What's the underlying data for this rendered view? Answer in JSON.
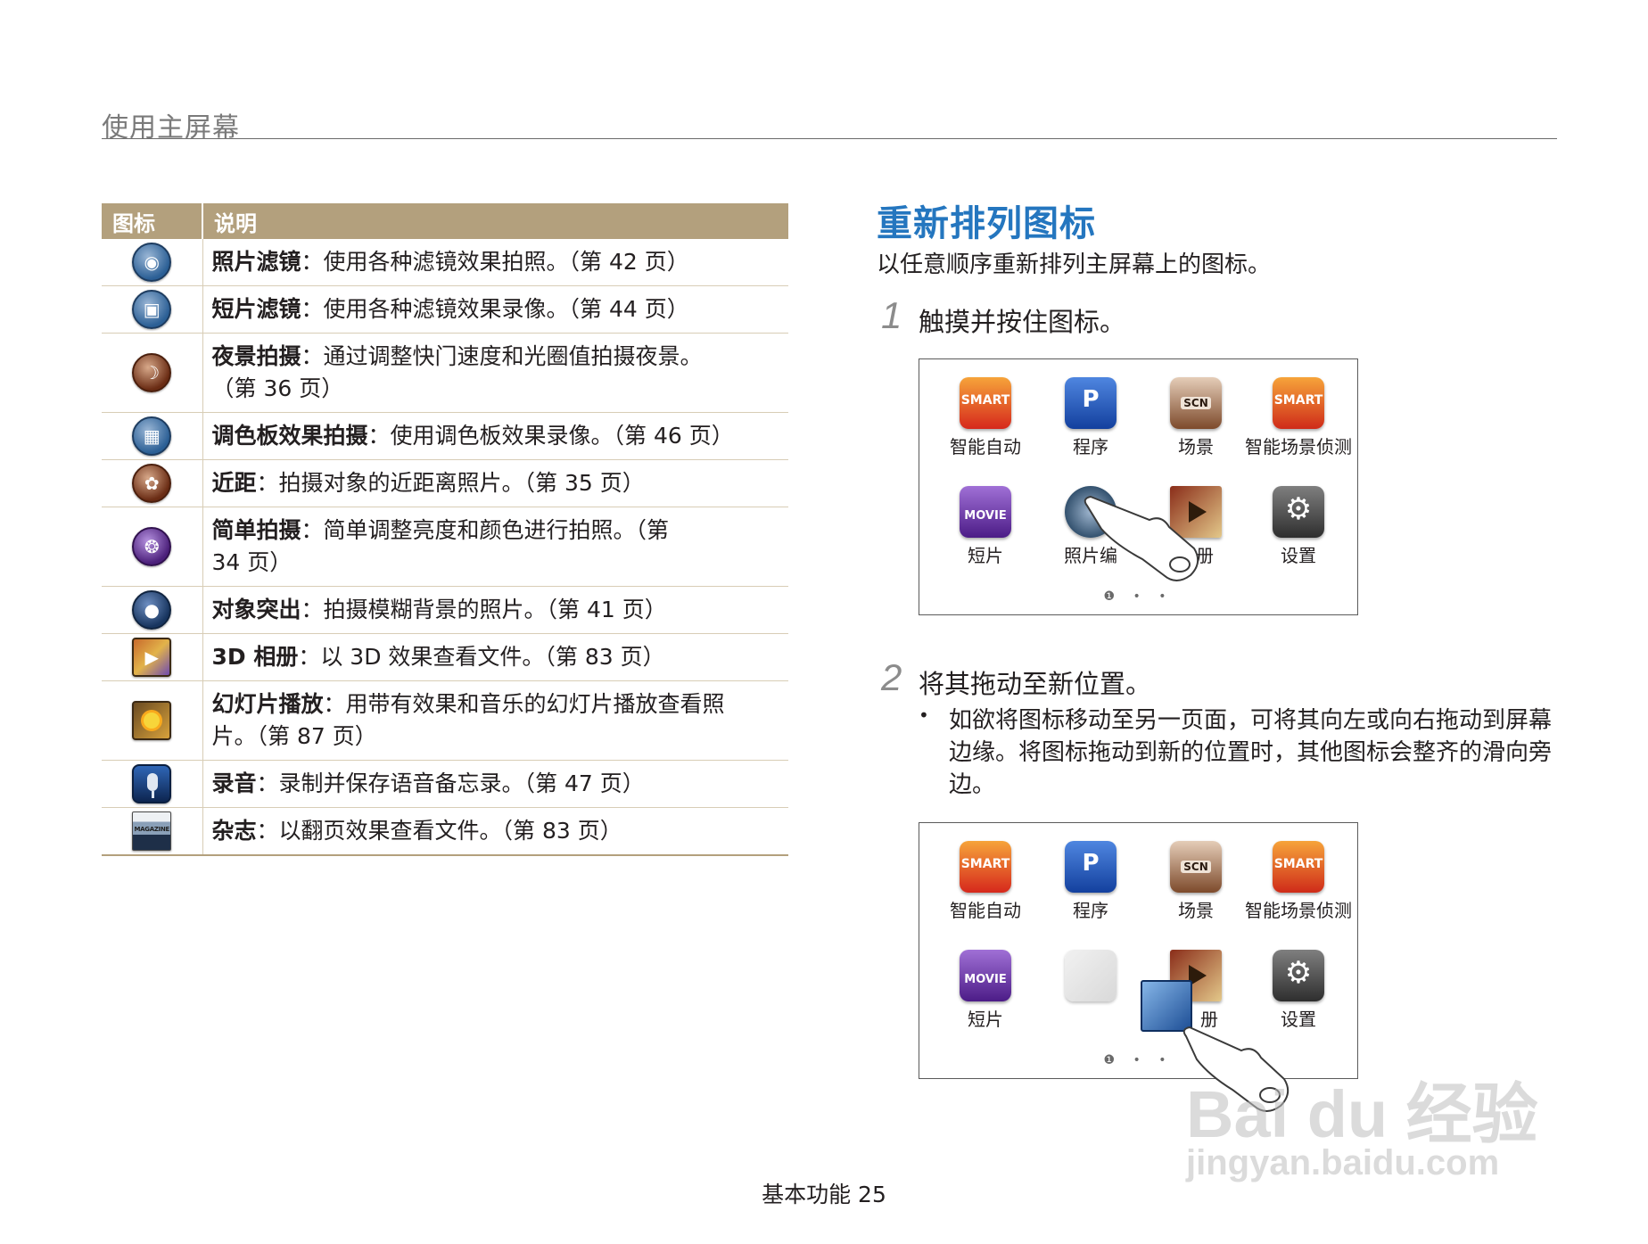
{
  "header": {
    "title": "使用主屏幕"
  },
  "table": {
    "col_icon": "图标",
    "col_desc": "说明",
    "rows": [
      {
        "icon": "photo-filter-icon",
        "name": "照片滤镜",
        "desc": "：使用各种滤镜效果拍照。（第 42 页）"
      },
      {
        "icon": "movie-filter-icon",
        "name": "短片滤镜",
        "desc": "：使用各种滤镜效果录像。（第 44 页）"
      },
      {
        "icon": "night-shot-icon",
        "name": "夜景拍摄",
        "desc": "：通过调整快门速度和光圈值拍摄夜景。（第 36 页）"
      },
      {
        "icon": "palette-effect-icon",
        "name": "调色板效果拍摄",
        "desc": "：使用调色板效果录像。（第 46 页）"
      },
      {
        "icon": "close-up-icon",
        "name": "近距",
        "desc": "：拍摄对象的近距离照片。（第 35 页）"
      },
      {
        "icon": "easy-shot-icon",
        "name": "简单拍摄",
        "desc": "：简单调整亮度和颜色进行拍照。（第 34 页）"
      },
      {
        "icon": "object-highlight-icon",
        "name": "对象突出",
        "desc": "：拍摄模糊背景的照片。（第 41 页）"
      },
      {
        "icon": "3d-album-icon",
        "name": "3D 相册",
        "desc": "：以 3D 效果查看文件。（第 83 页）"
      },
      {
        "icon": "slideshow-icon",
        "name": "幻灯片播放",
        "desc": "：用带有效果和音乐的幻灯片播放查看照片。（第 87 页）"
      },
      {
        "icon": "voice-record-icon",
        "name": "录音",
        "desc": "：录制并保存语音备忘录。（第 47 页）"
      },
      {
        "icon": "magazine-icon",
        "name": "杂志",
        "desc": "：以翻页效果查看文件。（第 83 页）"
      }
    ],
    "magazine_text": "MAGAZINE"
  },
  "section": {
    "title": "重新排列图标",
    "intro": "以任意顺序重新排列主屏幕上的图标。",
    "step1_num": "1",
    "step1_text": "触摸并按住图标。",
    "step2_num": "2",
    "step2_text": "将其拖动至新位置。",
    "bullet_mark": "•",
    "bullet_text": "如欲将图标移动至另一页面，可将其向左或向右拖动到屏幕边缘。将图标拖动到新的位置时，其他图标会整齐的滑向旁边。"
  },
  "screen1": {
    "apps": [
      {
        "icon": "smart-auto-icon",
        "badge": "SMART",
        "label": "智能自动"
      },
      {
        "icon": "program-icon",
        "badge": "P",
        "label": "程序"
      },
      {
        "icon": "scene-icon",
        "badge": "SCN",
        "label": "场景"
      },
      {
        "icon": "smart-scene-icon",
        "badge": "SMART",
        "label": "智能场景侦测"
      },
      {
        "icon": "movie-icon",
        "badge": "MOVIE",
        "label": "短片"
      },
      {
        "icon": "photo-edit-icon",
        "badge": "",
        "label": "照片编"
      },
      {
        "icon": "album-icon",
        "badge": "",
        "label": "相册"
      },
      {
        "icon": "settings-icon",
        "badge": "⚙",
        "label": "设置"
      }
    ],
    "dots": "❶ • •"
  },
  "screen2": {
    "apps": [
      {
        "icon": "smart-auto-icon",
        "badge": "SMART",
        "label": "智能自动"
      },
      {
        "icon": "program-icon",
        "badge": "P",
        "label": "程序"
      },
      {
        "icon": "scene-icon",
        "badge": "SCN",
        "label": "场景"
      },
      {
        "icon": "smart-scene-icon",
        "badge": "SMART",
        "label": "智能场景侦测"
      },
      {
        "icon": "movie-icon",
        "badge": "MOVIE",
        "label": "短片"
      },
      {
        "icon": "album-icon",
        "badge": "",
        "label": "册"
      },
      {
        "icon": "settings-icon",
        "badge": "⚙",
        "label": "设置"
      }
    ],
    "dots": "❶ • •"
  },
  "footer": {
    "text": "基本功能  25"
  },
  "watermark": {
    "brand": "Bai du 经验",
    "url": "jingyan.baidu.com"
  }
}
